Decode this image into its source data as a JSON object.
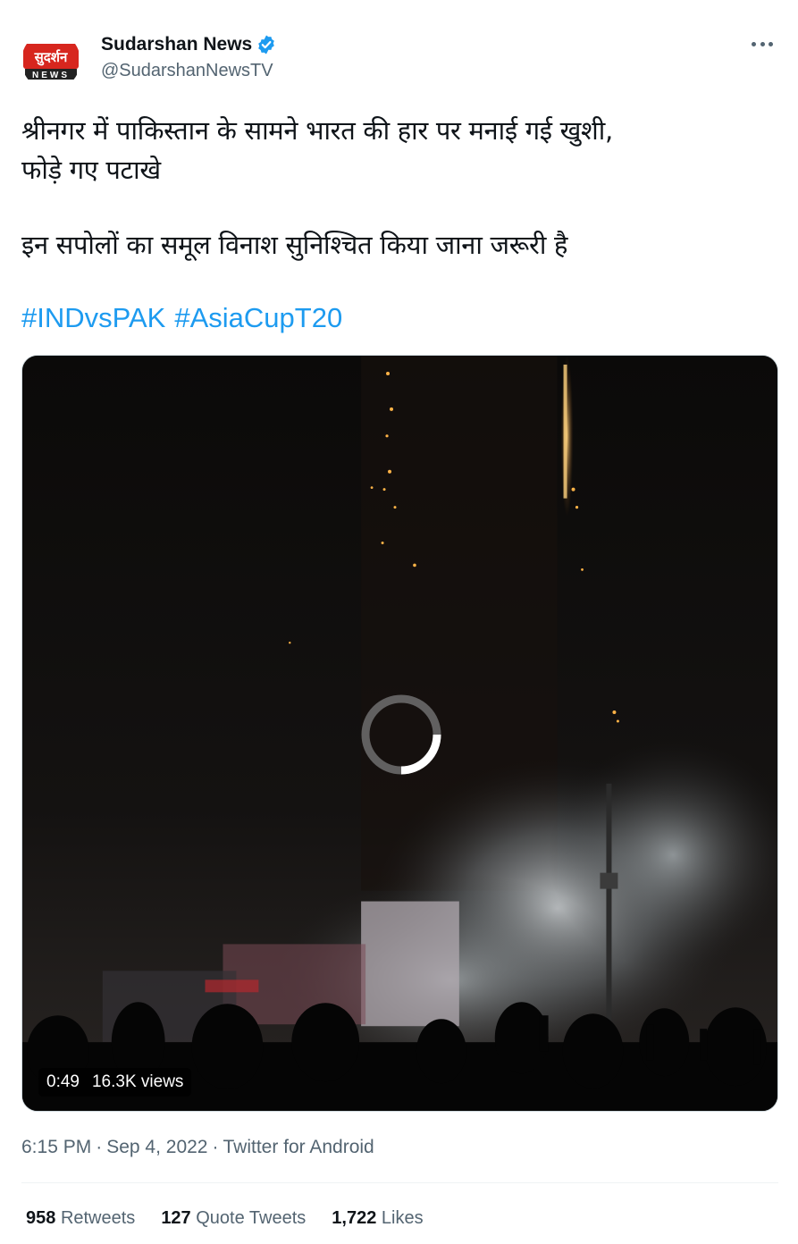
{
  "author": {
    "name": "Sudarshan News",
    "handle": "@SudarshanNewsTV",
    "avatar_logo_text": "सुदर्शन",
    "avatar_logo_sub": "NEWS",
    "verified_color": "#1d9bf0"
  },
  "tweet": {
    "line1": "श्रीनगर में पाकिस्तान के सामने भारत की हार पर मनाई गई खुशी,",
    "line2": "फोड़े गए पटाखे",
    "line3": "इन सपोलों का समूल विनाश सुनिश्चित किया जाना जरूरी है",
    "hashtags": [
      "#INDvsPAK",
      "#AsiaCupT20"
    ]
  },
  "video": {
    "duration": "0:49",
    "views": "16.3K views"
  },
  "meta": {
    "time": "6:15 PM",
    "date": "Sep 4, 2022",
    "source": "Twitter for Android",
    "separator": "·"
  },
  "stats": {
    "retweets_count": "958",
    "retweets_label": "Retweets",
    "quotes_count": "127",
    "quotes_label": "Quote Tweets",
    "likes_count": "1,722",
    "likes_label": "Likes"
  },
  "colors": {
    "link": "#1d9bf0",
    "secondary_text": "#536471",
    "primary_text": "#0f1419",
    "logo_red": "#d7261e"
  },
  "icons": [
    "verified-badge-icon",
    "more-options-icon",
    "loading-spinner-icon"
  ]
}
